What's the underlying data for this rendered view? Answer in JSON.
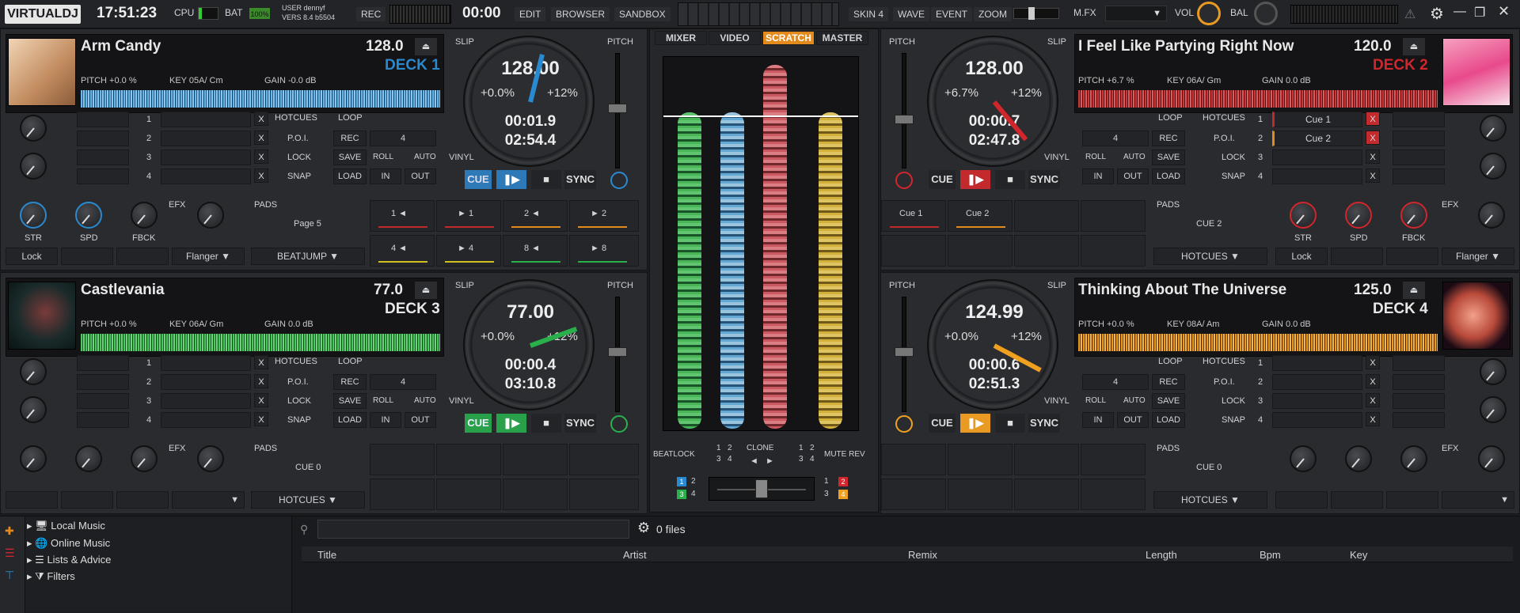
{
  "topbar": {
    "logo": "VIRTUALDJ",
    "clock": "17:51:23",
    "cpu_label": "CPU",
    "bat_label": "BAT",
    "bat_value": "100%",
    "user_line1": "USER dennyf",
    "user_line2": "VERS 8.4 b5504",
    "rec_label": "REC",
    "rec_time": "00:00",
    "menu": [
      "EDIT",
      "BROWSER",
      "SANDBOX"
    ],
    "layout": [
      "SKIN 4",
      "WAVE",
      "EVENT",
      "ZOOM"
    ],
    "mfx_label": "M.FX",
    "vol_label": "VOL",
    "bal_label": "BAL"
  },
  "mixer_tabs": [
    "MIXER",
    "VIDEO",
    "SCRATCH",
    "MASTER"
  ],
  "colors": {
    "deck1": "#2a8ad0",
    "deck2": "#d0262c",
    "deck3": "#29b04a",
    "deck4": "#f0a020",
    "scratch_tab": "#e38a1c"
  },
  "decks": [
    {
      "title": "Arm Candy",
      "bpm": "128.0",
      "label": "DECK 1",
      "pitch": "PITCH +0.0 %",
      "key": "KEY 05A/ Cm",
      "gain": "GAIN -0.0 dB",
      "jog_bpm": "128.00",
      "jog_pitch": "+0.0%",
      "jog_range": "+12%",
      "elapsed": "00:01.9",
      "remain": "02:54.4"
    },
    {
      "title": "I Feel Like Partying Right Now",
      "bpm": "120.0",
      "label": "DECK 2",
      "pitch": "PITCH +6.7 %",
      "key": "KEY 06A/ Gm",
      "gain": "GAIN 0.0 dB",
      "jog_bpm": "128.00",
      "jog_pitch": "+6.7%",
      "jog_range": "+12%",
      "elapsed": "00:00.7",
      "remain": "02:47.8"
    },
    {
      "title": "Castlevania",
      "bpm": "77.0",
      "label": "DECK 3",
      "pitch": "PITCH +0.0 %",
      "key": "KEY 06A/ Gm",
      "gain": "GAIN 0.0 dB",
      "jog_bpm": "77.00",
      "jog_pitch": "+0.0%",
      "jog_range": "+12%",
      "elapsed": "00:00.4",
      "remain": "03:10.8"
    },
    {
      "title": "Thinking About The Universe",
      "bpm": "125.0",
      "label": "DECK 4",
      "pitch": "PITCH +0.0 %",
      "key": "KEY 08A/ Am",
      "gain": "GAIN 0.0 dB",
      "jog_bpm": "124.99",
      "jog_pitch": "+0.0%",
      "jog_range": "+12%",
      "elapsed": "00:00.6",
      "remain": "02:51.3"
    }
  ],
  "labels": {
    "slip": "SLIP",
    "pitch": "PITCH",
    "vinyl": "VINYL",
    "hotcues": "HOTCUES",
    "loop": "LOOP",
    "poi": "P.O.I.",
    "lock": "LOCK",
    "snap": "SNAP",
    "rec": "REC",
    "save": "SAVE",
    "load": "LOAD",
    "roll": "ROLL",
    "auto": "AUTO",
    "in": "IN",
    "out": "OUT",
    "loop_size": "4",
    "cue": "CUE",
    "sync": "SYNC",
    "efx": "EFX",
    "pads": "PADS",
    "str": "STR",
    "spd": "SPD",
    "fbck": "FBCK",
    "lock_btn": "Lock",
    "flanger": "Flanger",
    "page5": "Page 5",
    "beatjump": "BEATJUMP",
    "cue2": "CUE 2",
    "cue0": "CUE 0",
    "hotcues_sel": "HOTCUES",
    "x": "X",
    "beatlock": "BEATLOCK",
    "clone": "CLONE",
    "mute_rev": "MUTE REV"
  },
  "cue_rows": [
    "1",
    "2",
    "3",
    "4"
  ],
  "deck2_cues": [
    "Cue 1",
    "Cue 2"
  ],
  "beatjump_pads": [
    "1 ◄",
    "► 1",
    "2 ◄",
    "► 2",
    "4 ◄",
    "► 4",
    "8 ◄",
    "► 8"
  ],
  "deck2_pads": [
    "Cue 1",
    "Cue 2"
  ],
  "mixer_nums": [
    "1",
    "2",
    "3",
    "4"
  ],
  "browser": {
    "tree": [
      "Local Music",
      "Online Music",
      "Lists & Advice",
      "Filters"
    ],
    "search_placeholder": "",
    "file_count": "0 files",
    "columns": [
      "Title",
      "Artist",
      "Remix",
      "Length",
      "Bpm",
      "Key"
    ]
  }
}
